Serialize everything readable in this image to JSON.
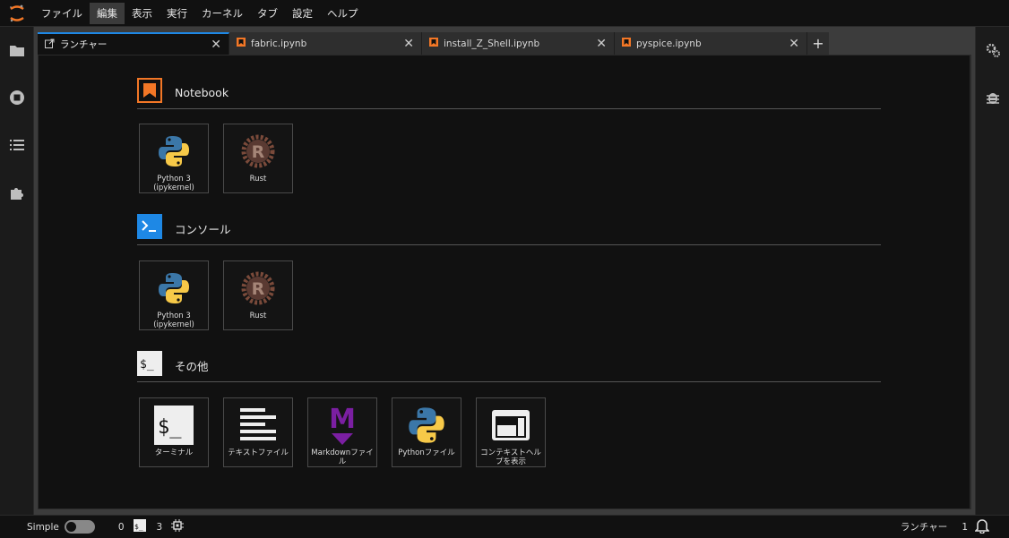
{
  "menubar": {
    "items": [
      "ファイル",
      "編集",
      "表示",
      "実行",
      "カーネル",
      "タブ",
      "設定",
      "ヘルプ"
    ],
    "active_index": 1
  },
  "left_sidebar": {
    "icons": [
      "folder-icon",
      "running-stop-icon",
      "toc-list-icon",
      "extension-puzzle-icon"
    ]
  },
  "right_sidebar": {
    "icons": [
      "property-inspector-gears-icon",
      "debugger-bug-icon"
    ]
  },
  "tabs": [
    {
      "label": "ランチャー",
      "icon": "launcher-icon",
      "active": true
    },
    {
      "label": "fabric.ipynb",
      "icon": "notebook-icon",
      "active": false
    },
    {
      "label": "install_Z_Shell.ipynb",
      "icon": "notebook-icon",
      "active": false
    },
    {
      "label": "pyspice.ipynb",
      "icon": "notebook-icon",
      "active": false
    }
  ],
  "launcher": {
    "sections": [
      {
        "title": "Notebook",
        "icon": "notebook-section-icon",
        "cards": [
          {
            "label": "Python 3 (ipykernel)",
            "icon": "python-logo-icon"
          },
          {
            "label": "Rust",
            "icon": "rust-logo-icon"
          }
        ]
      },
      {
        "title": "コンソール",
        "icon": "console-section-icon",
        "cards": [
          {
            "label": "Python 3 (ipykernel)",
            "icon": "python-logo-icon"
          },
          {
            "label": "Rust",
            "icon": "rust-logo-icon"
          }
        ]
      },
      {
        "title": "その他",
        "icon": "other-section-icon",
        "cards": [
          {
            "label": "ターミナル",
            "icon": "terminal-icon"
          },
          {
            "label": "テキストファイル",
            "icon": "text-file-icon"
          },
          {
            "label": "Markdownファイル",
            "icon": "markdown-icon"
          },
          {
            "label": "Pythonファイル",
            "icon": "python-logo-icon"
          },
          {
            "label": "コンテキストヘルプを表示",
            "icon": "context-help-icon"
          }
        ]
      }
    ]
  },
  "statusbar": {
    "mode_label": "Simple",
    "simple_mode_on": false,
    "kernel_count": "0",
    "terminal_count": "3",
    "current_activity": "ランチャー",
    "notification_count": "1"
  },
  "colors": {
    "accent": "#1e88e5",
    "notebook_orange": "#f37726",
    "console_blue": "#1e88e5",
    "markdown_purple": "#7b1fa2"
  }
}
